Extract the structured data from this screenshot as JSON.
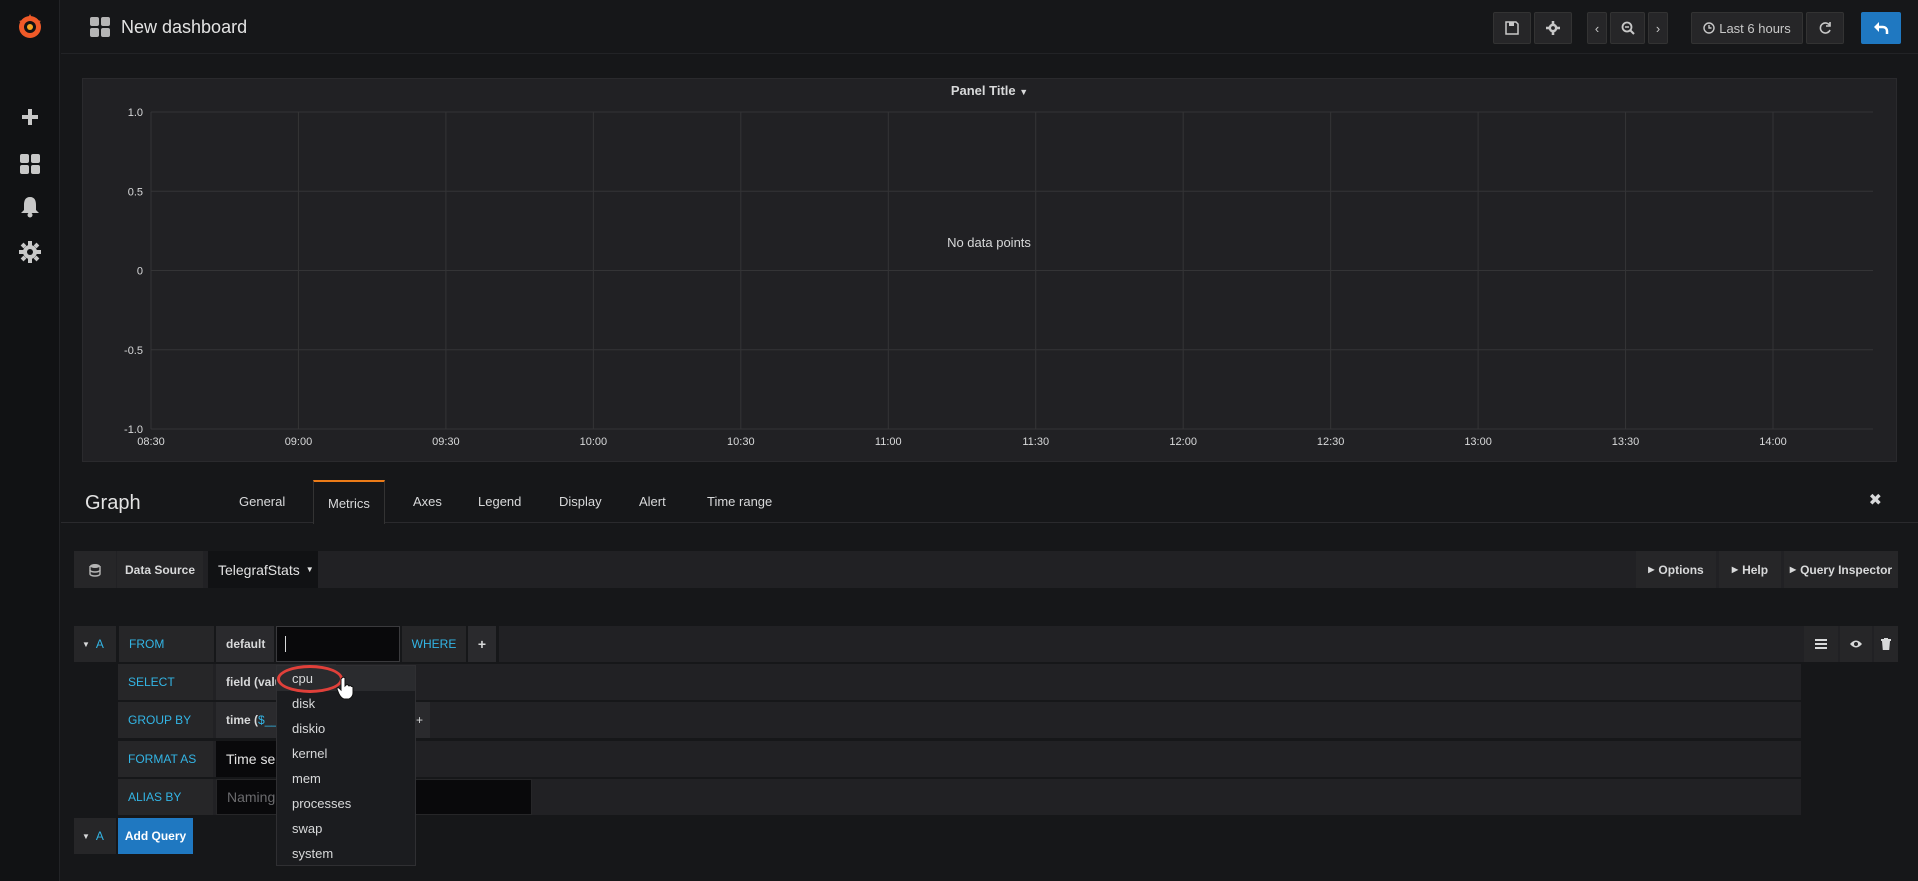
{
  "header": {
    "title": "New dashboard",
    "time_range": "Last 6 hours"
  },
  "panel": {
    "title": "Panel Title",
    "no_data": "No data points",
    "y_ticks": [
      "1.0",
      "0.5",
      "0",
      "-0.5",
      "-1.0"
    ],
    "x_ticks": [
      "08:30",
      "09:00",
      "09:30",
      "10:00",
      "10:30",
      "11:00",
      "11:30",
      "12:00",
      "12:30",
      "13:00",
      "13:30",
      "14:00"
    ]
  },
  "editor": {
    "name": "Graph",
    "tabs": [
      {
        "label": "General"
      },
      {
        "label": "Metrics"
      },
      {
        "label": "Axes"
      },
      {
        "label": "Legend"
      },
      {
        "label": "Display"
      },
      {
        "label": "Alert"
      },
      {
        "label": "Time range"
      }
    ],
    "active_tab": "Metrics"
  },
  "datasource": {
    "label": "Data Source",
    "value": "TelegrafStats",
    "options_btn": "Options",
    "help_btn": "Help",
    "inspector_btn": "Query Inspector"
  },
  "query": {
    "ref": "A",
    "from_label": "FROM",
    "from_policy": "default",
    "from_measurement": "",
    "where_label": "WHERE",
    "select_label": "SELECT",
    "select_value": "field (valu",
    "groupby_label": "GROUP BY",
    "groupby_value_a": "time (",
    "groupby_value_b": "$__",
    "format_label": "FORMAT AS",
    "format_value": "Time se",
    "alias_label": "ALIAS BY",
    "alias_placeholder": "Naming",
    "add_query": "Add Query",
    "add_ref": "A"
  },
  "measurements": [
    {
      "label": "cpu"
    },
    {
      "label": "disk"
    },
    {
      "label": "diskio"
    },
    {
      "label": "kernel"
    },
    {
      "label": "mem"
    },
    {
      "label": "processes"
    },
    {
      "label": "swap"
    },
    {
      "label": "system"
    }
  ],
  "colors": {
    "accent": "#eb7b18",
    "label_blue": "#33b5e5",
    "primary_button": "#1f78c1",
    "highlight_circle": "#e0403a"
  }
}
